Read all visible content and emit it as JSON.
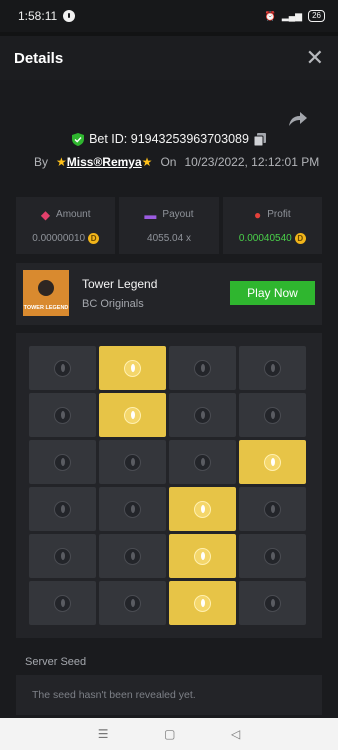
{
  "statusbar": {
    "time": "1:58:11",
    "battery": "26"
  },
  "header": {
    "title": "Details",
    "close": "✕"
  },
  "bet": {
    "id_text": "Bet ID: 91943253963703089",
    "by_label": "By",
    "user": "Miss®Remya",
    "on_label": "On",
    "date": "10/23/2022, 12:12:01 PM"
  },
  "stats": [
    {
      "label": "Amount",
      "value": "0.00000010",
      "icon": "money-icon",
      "color": "#e3406c"
    },
    {
      "label": "Payout",
      "value": "4055.04 x",
      "icon": "wallet-icon",
      "color": "#9b5be0"
    },
    {
      "label": "Profit",
      "value": "0.00040540",
      "icon": "user-up-icon",
      "color": "#e3403a"
    }
  ],
  "game": {
    "name": "Tower Legend",
    "provider": "BC Originals",
    "play_label": "Play Now",
    "thumb_text": "TOWER LEGEND"
  },
  "board": {
    "rows": [
      [
        0,
        1,
        0,
        0
      ],
      [
        0,
        1,
        0,
        0
      ],
      [
        0,
        0,
        0,
        1
      ],
      [
        0,
        0,
        1,
        0
      ],
      [
        0,
        0,
        1,
        0
      ],
      [
        0,
        0,
        1,
        0
      ]
    ],
    "colors": {
      "gold": "#e7c447",
      "dark": "#34363b"
    }
  },
  "seed": {
    "label": "Server Seed",
    "text": "The seed hasn't been revealed yet."
  },
  "navbar": {
    "menu": "☰",
    "home": "▢",
    "back": "◁"
  }
}
